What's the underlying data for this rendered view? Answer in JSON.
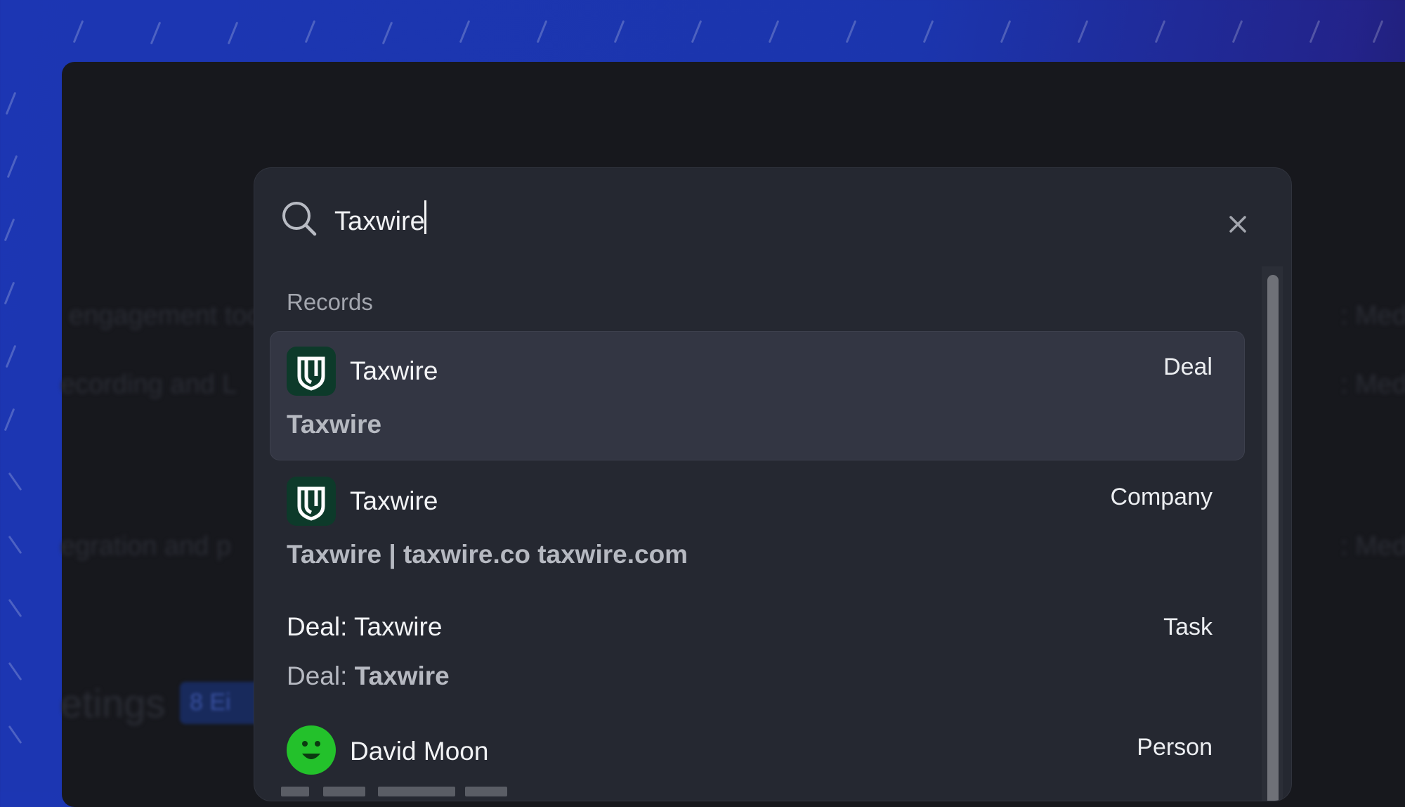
{
  "search": {
    "query": "Taxwire"
  },
  "section_label": "Records",
  "results": [
    {
      "title": "Taxwire",
      "type": "Deal",
      "sub_bold": "Taxwire",
      "sub_plain": "",
      "icon": "taxwire-logo-icon",
      "active": true
    },
    {
      "title": "Taxwire",
      "type": "Company",
      "sub_bold": "Taxwire | taxwire.co taxwire.com",
      "sub_plain": "",
      "icon": "taxwire-logo-icon",
      "active": false
    },
    {
      "title": "Deal: Taxwire",
      "type": "Task",
      "sub_plain": "Deal: ",
      "sub_bold": "Taxwire",
      "icon": "",
      "active": false
    },
    {
      "title": "David Moon",
      "type": "Person",
      "icon": "smiley-avatar-icon",
      "active": false
    }
  ],
  "colors": {
    "accent_bg": "#1c36b3",
    "panel": "#252831",
    "active_row": "#333643",
    "brand_logo": "#0d3a2a",
    "avatar_green": "#23c12b"
  }
}
